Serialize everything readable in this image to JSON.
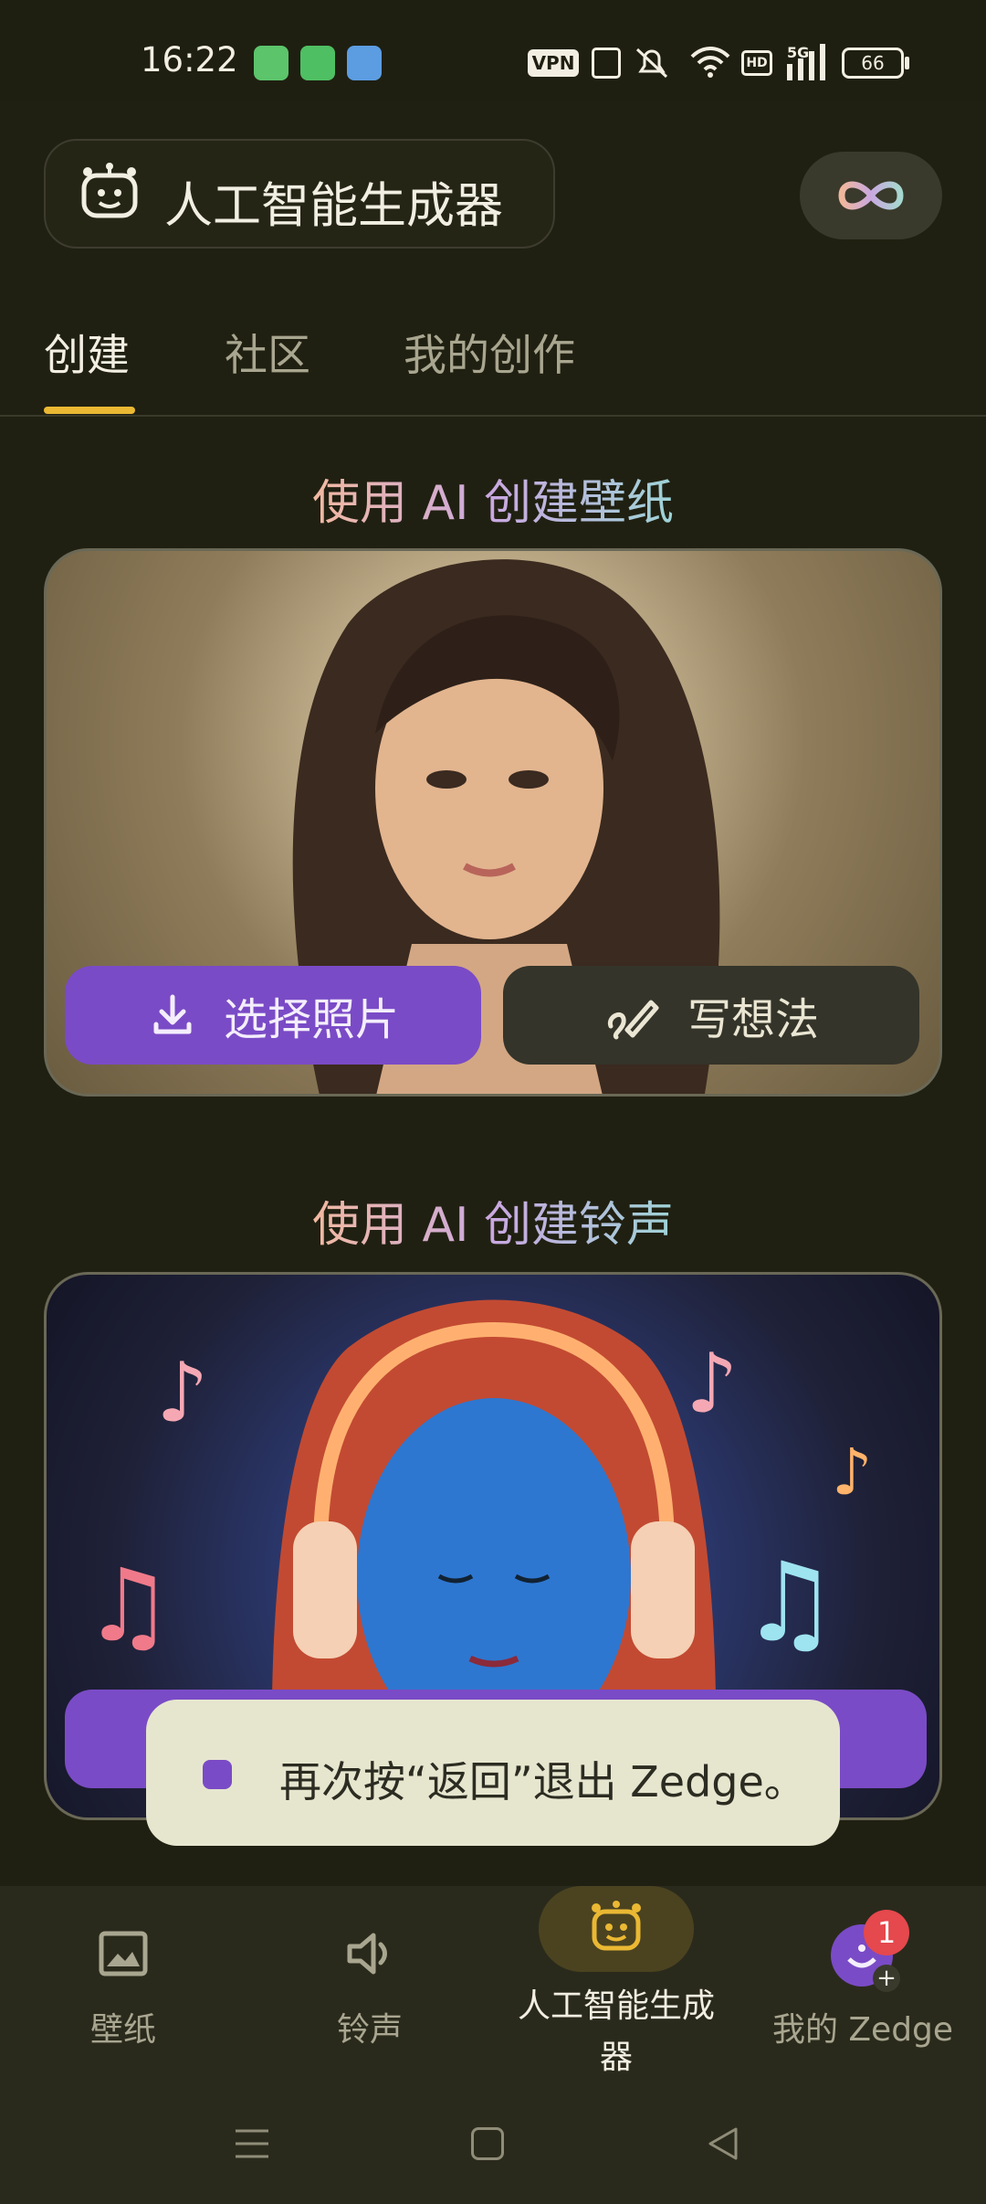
{
  "status_bar": {
    "time": "16:22",
    "right_icons": [
      "vpn-icon",
      "nfc-icon",
      "mute-icon",
      "wifi-icon",
      "hd-icon",
      "signal-5g-icon",
      "battery-icon"
    ],
    "vpn": "VPN",
    "hd": "HD",
    "network": "5G",
    "battery": "66"
  },
  "header": {
    "title": "人工智能生成器"
  },
  "tabs": [
    {
      "label": "创建",
      "active": true
    },
    {
      "label": "社区",
      "active": false
    },
    {
      "label": "我的创作",
      "active": false
    }
  ],
  "sections": [
    {
      "heading": "使用 AI 创建壁纸",
      "buttons": [
        {
          "label": "选择照片",
          "icon": "download-icon"
        },
        {
          "label": "写想法",
          "icon": "pen-icon"
        }
      ]
    },
    {
      "heading": "使用 AI 创建铃声",
      "buttons": []
    }
  ],
  "toast": {
    "text": "再次按“返回”退出 Zedge。"
  },
  "bottom_nav": [
    {
      "label": "壁纸",
      "icon": "image-icon"
    },
    {
      "label": "铃声",
      "icon": "speaker-icon"
    },
    {
      "label_line1": "人工智能生成",
      "label_line2": "器",
      "icon": "robot-icon",
      "active": true
    },
    {
      "label": "我的 Zedge",
      "icon": "profile-icon",
      "badge": "1"
    }
  ],
  "colors": {
    "background": "#202012",
    "accent_purple": "#7a4bc6",
    "tab_underline": "#eab833",
    "badge_red": "#e5484d"
  }
}
